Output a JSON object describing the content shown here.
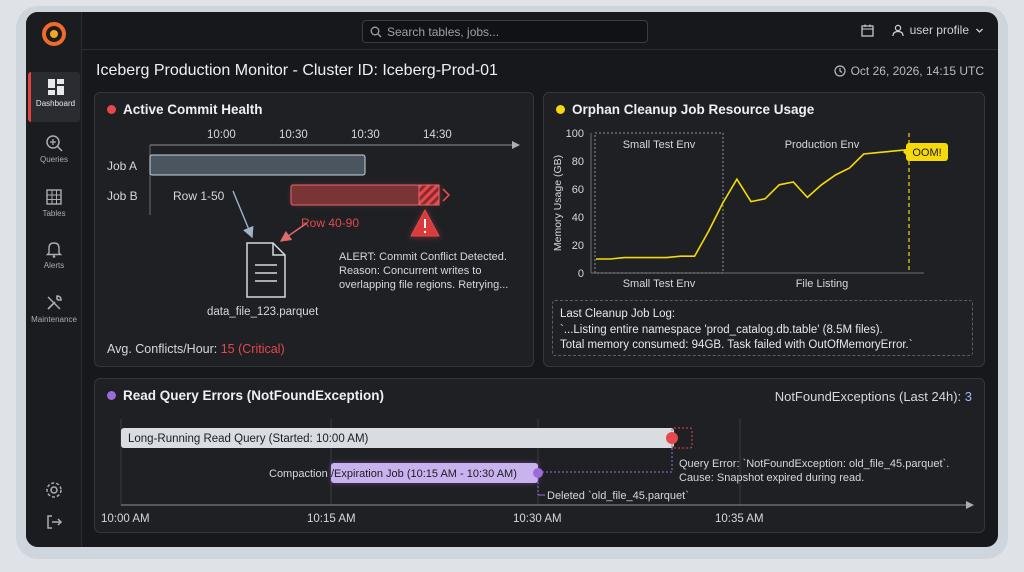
{
  "search": {
    "placeholder": "Search tables, jobs..."
  },
  "user": {
    "label": "user profile"
  },
  "sidebar": {
    "items": [
      {
        "label": "Dashboard",
        "icon": "dashboard-icon",
        "active": true
      },
      {
        "label": "Queries",
        "icon": "search-plus-icon"
      },
      {
        "label": "Tables",
        "icon": "table-icon"
      },
      {
        "label": "Alerts",
        "icon": "bell-icon"
      },
      {
        "label": "Maintenance",
        "icon": "wrench-icon"
      }
    ]
  },
  "header": {
    "title": "Iceberg Production Monitor - Cluster ID: Iceberg-Prod-01",
    "timestamp": "Oct 26, 2026, 14:15 UTC"
  },
  "commit_panel": {
    "title": "Active Commit Health",
    "dot_color": "#e5484d",
    "ticks": [
      "10:00",
      "10:30",
      "10:30",
      "14:30"
    ],
    "job_a": "Job A",
    "job_b": "Job B",
    "row_a": "Row 1-50",
    "row_b": "Row 40-90",
    "file": "data_file_123.parquet",
    "alert_line1": "ALERT: Commit Conflict Detected.",
    "alert_line2": "Reason: Concurrent writes to",
    "alert_line3": "overlapping file regions. Retrying...",
    "footer_label": "Avg. Conflicts/Hour:",
    "footer_value": "15 (Critical)"
  },
  "orphan_panel": {
    "title": "Orphan Cleanup Job Resource Usage",
    "dot_color": "#f5d90a",
    "region_small": "Small Test Env",
    "region_prod": "Production Env",
    "oom_label": "OOM!",
    "log_title": "Last Cleanup Job Log:",
    "log_line1": "`...Listing entire namespace 'prod_catalog.db.table' (8.5M files).",
    "log_line2": "Total memory consumed: 94GB. Task failed with OutOfMemoryError.`"
  },
  "chart_data": {
    "type": "line",
    "ylabel": "Memory Usage (GB)",
    "ylim": [
      0,
      100
    ],
    "yticks": [
      "100",
      "80",
      "60",
      "40",
      "20",
      "0"
    ],
    "xticks": [
      "Small Test Env",
      "File Listing"
    ],
    "grid": false,
    "series": [
      {
        "values": [
          [
            0,
            10
          ],
          [
            1,
            10
          ],
          [
            2,
            11
          ],
          [
            3,
            11
          ],
          [
            4,
            11
          ],
          [
            5,
            11
          ],
          [
            6,
            12
          ],
          [
            7,
            12
          ],
          [
            8,
            30
          ],
          [
            9,
            50
          ],
          [
            10,
            67
          ],
          [
            11,
            51
          ],
          [
            12,
            53
          ],
          [
            13,
            63
          ],
          [
            14,
            65
          ],
          [
            15,
            54
          ],
          [
            16,
            63
          ],
          [
            17,
            70
          ],
          [
            18,
            75
          ],
          [
            19,
            85
          ],
          [
            20,
            86
          ],
          [
            21,
            87
          ],
          [
            22,
            88
          ]
        ]
      }
    ]
  },
  "errors_panel": {
    "title": "Read Query Errors (NotFoundException)",
    "dot_color": "#9b6bd8",
    "count_label": "NotFoundExceptions (Last 24h):",
    "count_value": "3",
    "long_query": "Long-Running Read Query (Started: 10:00 AM)",
    "compaction_label": "Compaction",
    "expiration_job": "/Expiration Job (10:15 AM - 10:30 AM)",
    "error_line1": "Query Error: `NotFoundException: old_file_45.parquet`.",
    "error_line2": "Cause: Snapshot expired during read.",
    "deleted_note": "Deleted `old_file_45.parquet`",
    "ticks": [
      "10:00 AM",
      "10:15 AM",
      "10:30 AM",
      "10:35 AM"
    ]
  }
}
